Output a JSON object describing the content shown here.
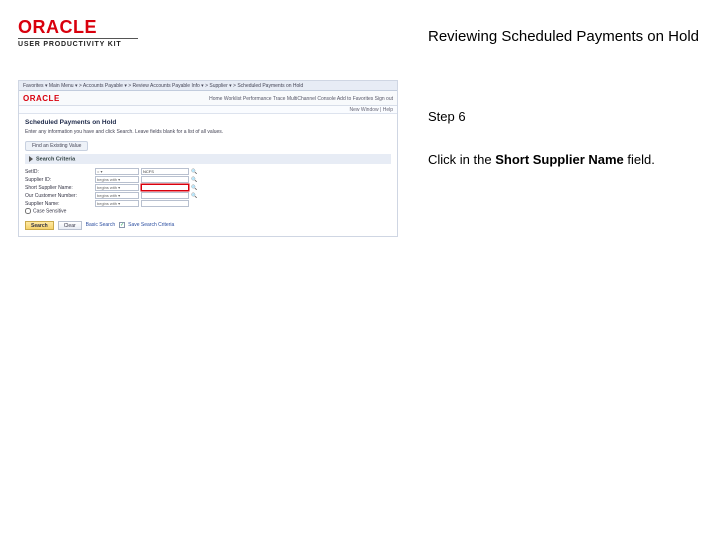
{
  "header": {
    "oracle": "ORACLE",
    "upk": "USER PRODUCTIVITY KIT"
  },
  "title": "Reviewing Scheduled Payments on Hold",
  "step": "Step 6",
  "instruction_prefix": "Click in the ",
  "instruction_bold": "Short Supplier Name",
  "instruction_suffix": " field.",
  "app": {
    "breadcrumb": "Favorites ▾   Main Menu ▾   > Accounts Payable ▾ > Review Accounts Payable Info ▾ > Supplier ▾ > Scheduled Payments on Hold",
    "brand": "ORACLE",
    "toplinks": "Home   Worklist   Performance Trace   MultiChannel Console   Add to Favorites   Sign out",
    "signin": "New Window | Help",
    "page_title": "Scheduled Payments on Hold",
    "page_sub": "Enter any information you have and click Search. Leave fields blank for a list of all values.",
    "tab": "Find an Existing Value",
    "search_criteria": "Search Criteria",
    "fields": {
      "setid": {
        "label": "SetID:",
        "op": "= ▾",
        "val": "NCFS"
      },
      "supplier_id": {
        "label": "Supplier ID:",
        "op": "begins with ▾",
        "val": ""
      },
      "short_supplier_name": {
        "label": "Short Supplier Name:",
        "op": "begins with ▾",
        "val": ""
      },
      "our_customer_number": {
        "label": "Our Customer Number:",
        "op": "begins with ▾",
        "val": ""
      },
      "supplier_name": {
        "label": "Supplier Name:",
        "op": "begins with ▾",
        "val": ""
      },
      "case_sensitive": {
        "label": "Case Sensitive"
      }
    },
    "buttons": {
      "search": "Search",
      "clear": "Clear",
      "basic": "Basic Search",
      "save": "Save Search Criteria"
    }
  }
}
